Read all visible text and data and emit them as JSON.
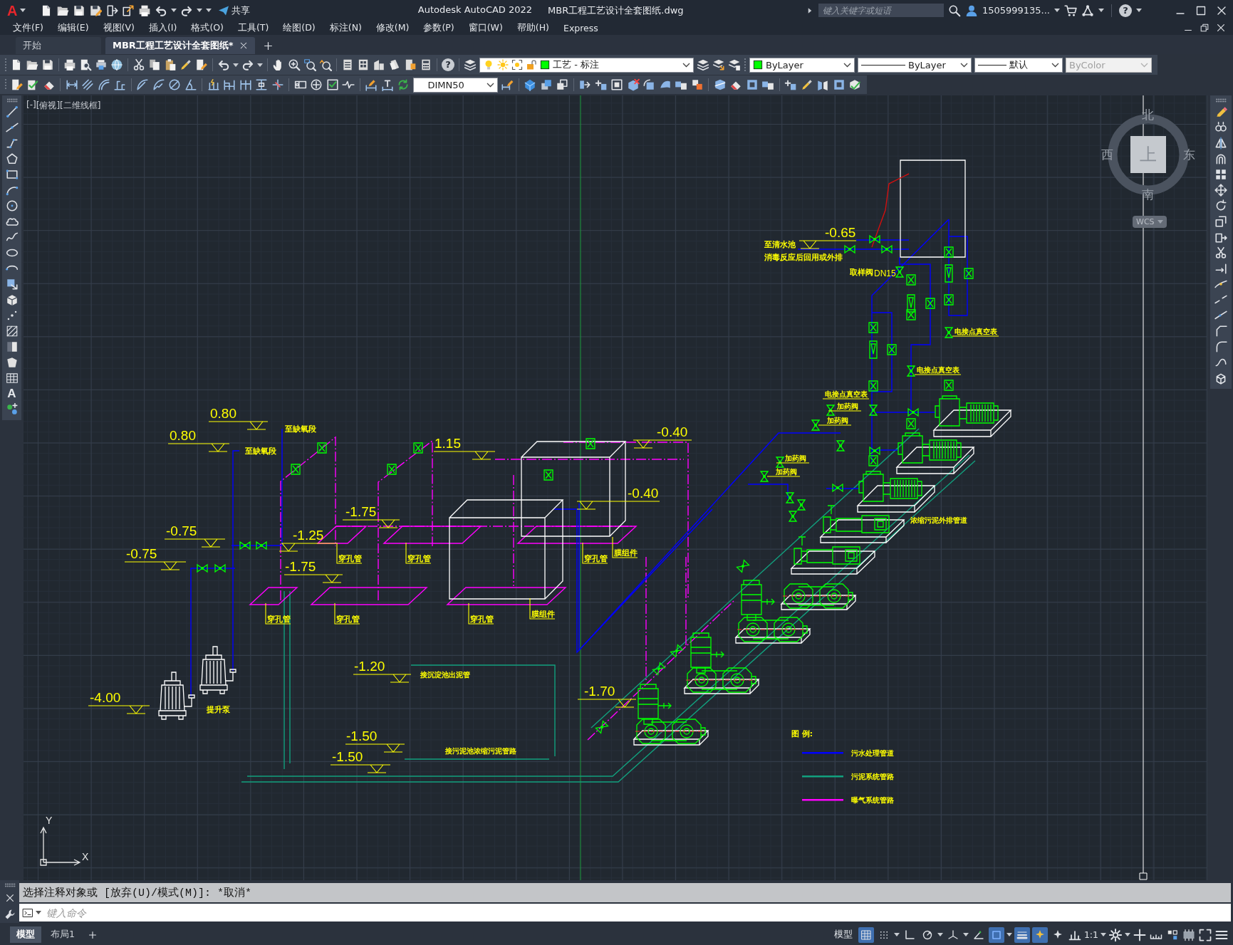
{
  "title_bar": {
    "logo": "A",
    "share_label": "共享",
    "app_name": "Autodesk AutoCAD 2022",
    "file_name": "MBR工程工艺设计全套图纸.dwg",
    "search": {
      "placeholder": "键入关键字或短语"
    },
    "user_name": "1505999135...",
    "help_glyph": "?"
  },
  "menu_bar": {
    "items": [
      "文件(F)",
      "编辑(E)",
      "视图(V)",
      "插入(I)",
      "格式(O)",
      "工具(T)",
      "绘图(D)",
      "标注(N)",
      "修改(M)",
      "参数(P)",
      "窗口(W)",
      "帮助(H)",
      "Express"
    ]
  },
  "file_tabs": [
    {
      "label": "开始",
      "selected": false,
      "closable": false
    },
    {
      "label": "MBR工程工艺设计全套图纸*",
      "selected": true,
      "closable": true
    }
  ],
  "toolbar": {
    "help_glyph": "?",
    "layer": {
      "value": "工艺 - 标注"
    },
    "properties": [
      {
        "kind": "color",
        "value": "ByLayer",
        "disabled": false
      },
      {
        "kind": "linetype",
        "value": "ByLayer",
        "disabled": false
      },
      {
        "kind": "lineweight",
        "value": "默认",
        "disabled": false
      },
      {
        "kind": "plotstyle",
        "value": "ByColor",
        "disabled": true
      }
    ],
    "dim_style": {
      "value": "DIMN50"
    }
  },
  "draw_palette": {
    "text_glyph": "A"
  },
  "viewport": {
    "controls": [
      "[-]",
      "[俯视]",
      "[二维线框]"
    ],
    "viewcube": {
      "north": "北",
      "west": "西",
      "east": "东",
      "south": "南",
      "top": "上",
      "wcs": "WCS"
    },
    "ucs": {
      "y": "Y",
      "x": "X"
    }
  },
  "drawing": {
    "elevations": [
      "-0.65",
      "0.80",
      "-0.40",
      "0.80",
      "1.15",
      "-0.40",
      "-1.75",
      "-0.75",
      "-1.25",
      "-0.75",
      "-1.75",
      "-1.20",
      "-1.70",
      "-4.00",
      "-1.50",
      "-1.50"
    ],
    "notes": [
      "至清水池",
      "消毒反应后回用或外排",
      "取样阀",
      "DN15",
      "电接点真空表",
      "电接点真空表",
      "电接点真空表",
      "加药阀",
      "加药阀",
      "至缺氧段",
      "至缺氧段",
      "加药阀",
      "加药阀",
      "浓缩污泥外排管道",
      "膜组件",
      "穿孔管",
      "穿孔管",
      "穿孔管",
      "膜组件",
      "穿孔管",
      "穿孔管",
      "穿孔管",
      "接沉淀池出泥管",
      "提升泵",
      "接污泥池浓缩污泥管路"
    ],
    "legend": {
      "title": "图 例:",
      "items": [
        {
          "label": "污水处理管道",
          "color": "#0000ff"
        },
        {
          "label": "污泥系统管路",
          "color": "#12a07e"
        },
        {
          "label": "曝气系统管路",
          "color": "#ff00ff"
        }
      ]
    }
  },
  "command_line": {
    "history": "选择注释对象或 [放弃(U)/模式(M)]: *取消*",
    "input": {
      "placeholder": "键入命令"
    }
  },
  "layout_tabs": [
    {
      "label": "模型",
      "selected": true
    },
    {
      "label": "布局1",
      "selected": false
    }
  ],
  "status_bar": {
    "model_label": "模型",
    "toggles": [
      {
        "kind": "grid",
        "on": true
      },
      {
        "kind": "snap",
        "on": false
      },
      {
        "kind": "ortho",
        "on": false
      },
      {
        "kind": "polar",
        "on": false
      },
      {
        "kind": "isodraft",
        "on": false
      },
      {
        "kind": "otrack",
        "on": false
      },
      {
        "kind": "osnap",
        "on": true
      },
      {
        "kind": "lineweight",
        "on": true
      },
      {
        "kind": "annotation_visibility",
        "on": true
      },
      {
        "kind": "autoscale",
        "on": false
      }
    ],
    "annotation_scale": "1:1"
  }
}
